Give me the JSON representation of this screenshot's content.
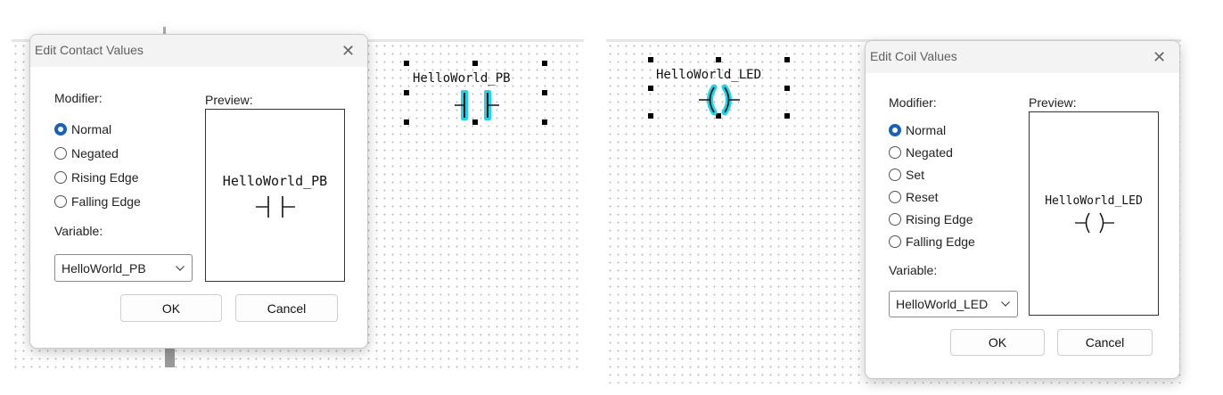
{
  "contact_dialog": {
    "title": "Edit Contact Values",
    "modifier_label": "Modifier:",
    "preview_label": "Preview:",
    "options": [
      "Normal",
      "Negated",
      "Rising Edge",
      "Falling Edge"
    ],
    "selected_option": "Normal",
    "variable_label": "Variable:",
    "variable_value": "HelloWorld_PB",
    "preview_text": "HelloWorld_PB",
    "ok_label": "OK",
    "cancel_label": "Cancel"
  },
  "coil_dialog": {
    "title": "Edit Coil Values",
    "modifier_label": "Modifier:",
    "preview_label": "Preview:",
    "options": [
      "Normal",
      "Negated",
      "Set",
      "Reset",
      "Rising Edge",
      "Falling Edge"
    ],
    "selected_option": "Normal",
    "variable_label": "Variable:",
    "variable_value": "HelloWorld_LED",
    "preview_text": "HelloWorld_LED",
    "ok_label": "OK",
    "cancel_label": "Cancel"
  },
  "canvas": {
    "contact_label": "HelloWorld_PB",
    "coil_label": "HelloWorld_LED"
  },
  "colors": {
    "selection_highlight": "#1ed4e6",
    "radio_accent": "#1a62b8"
  }
}
